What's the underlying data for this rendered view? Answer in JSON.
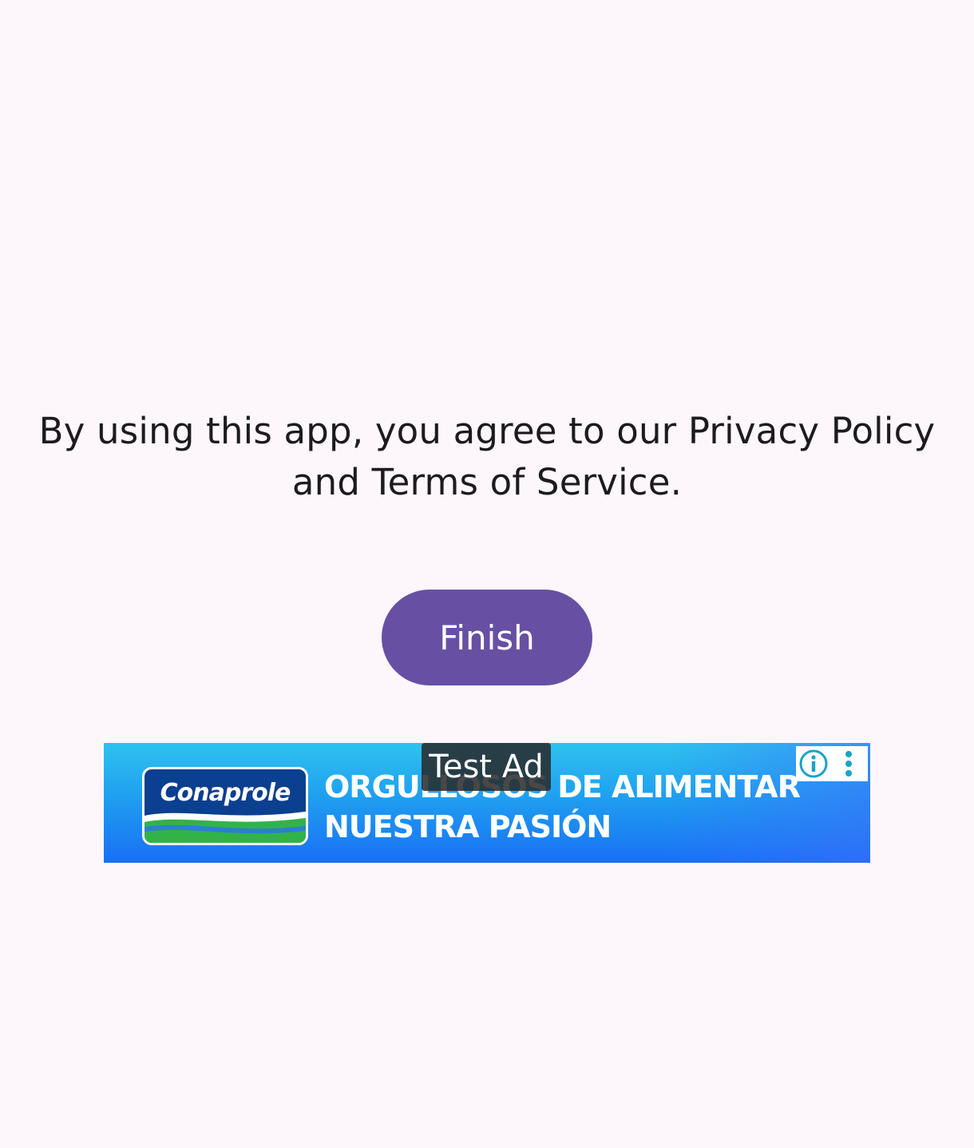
{
  "agreement": {
    "text": "By using this app, you agree to our Privacy Policy and Terms of Service."
  },
  "finish_button": {
    "label": "Finish"
  },
  "ad": {
    "badge": "Test Ad",
    "brand": "Conaprole",
    "headline_line1": "ORGULLOSOS DE ALIMENTAR",
    "headline_line2": "NUESTRA PASIÓN",
    "info_icon": "info-icon",
    "menu_icon": "more-vert-icon"
  },
  "colors": {
    "background": "#fdf7fc",
    "primary": "#6750a4",
    "text": "#1c1b1f",
    "ad_choices_accent": "#1aa3c8"
  }
}
